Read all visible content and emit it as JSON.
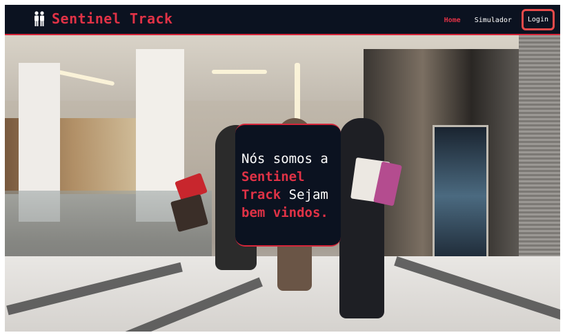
{
  "brand": {
    "name": "Sentinel Track",
    "logo_icon": "people-icon"
  },
  "nav": {
    "items": [
      {
        "label": "Home",
        "active": true
      },
      {
        "label": "Simulador",
        "active": false
      },
      {
        "label": "Login",
        "active": false,
        "highlighted": true
      }
    ]
  },
  "hero": {
    "welcome": {
      "part1": "Nós somos a",
      "brand": "Sentinel Track",
      "part2": "Sejam",
      "emphasis": "bem vindos."
    }
  },
  "colors": {
    "accent": "#e03246",
    "navbar_bg": "#0b1220",
    "login_outline": "#e84a4a"
  }
}
